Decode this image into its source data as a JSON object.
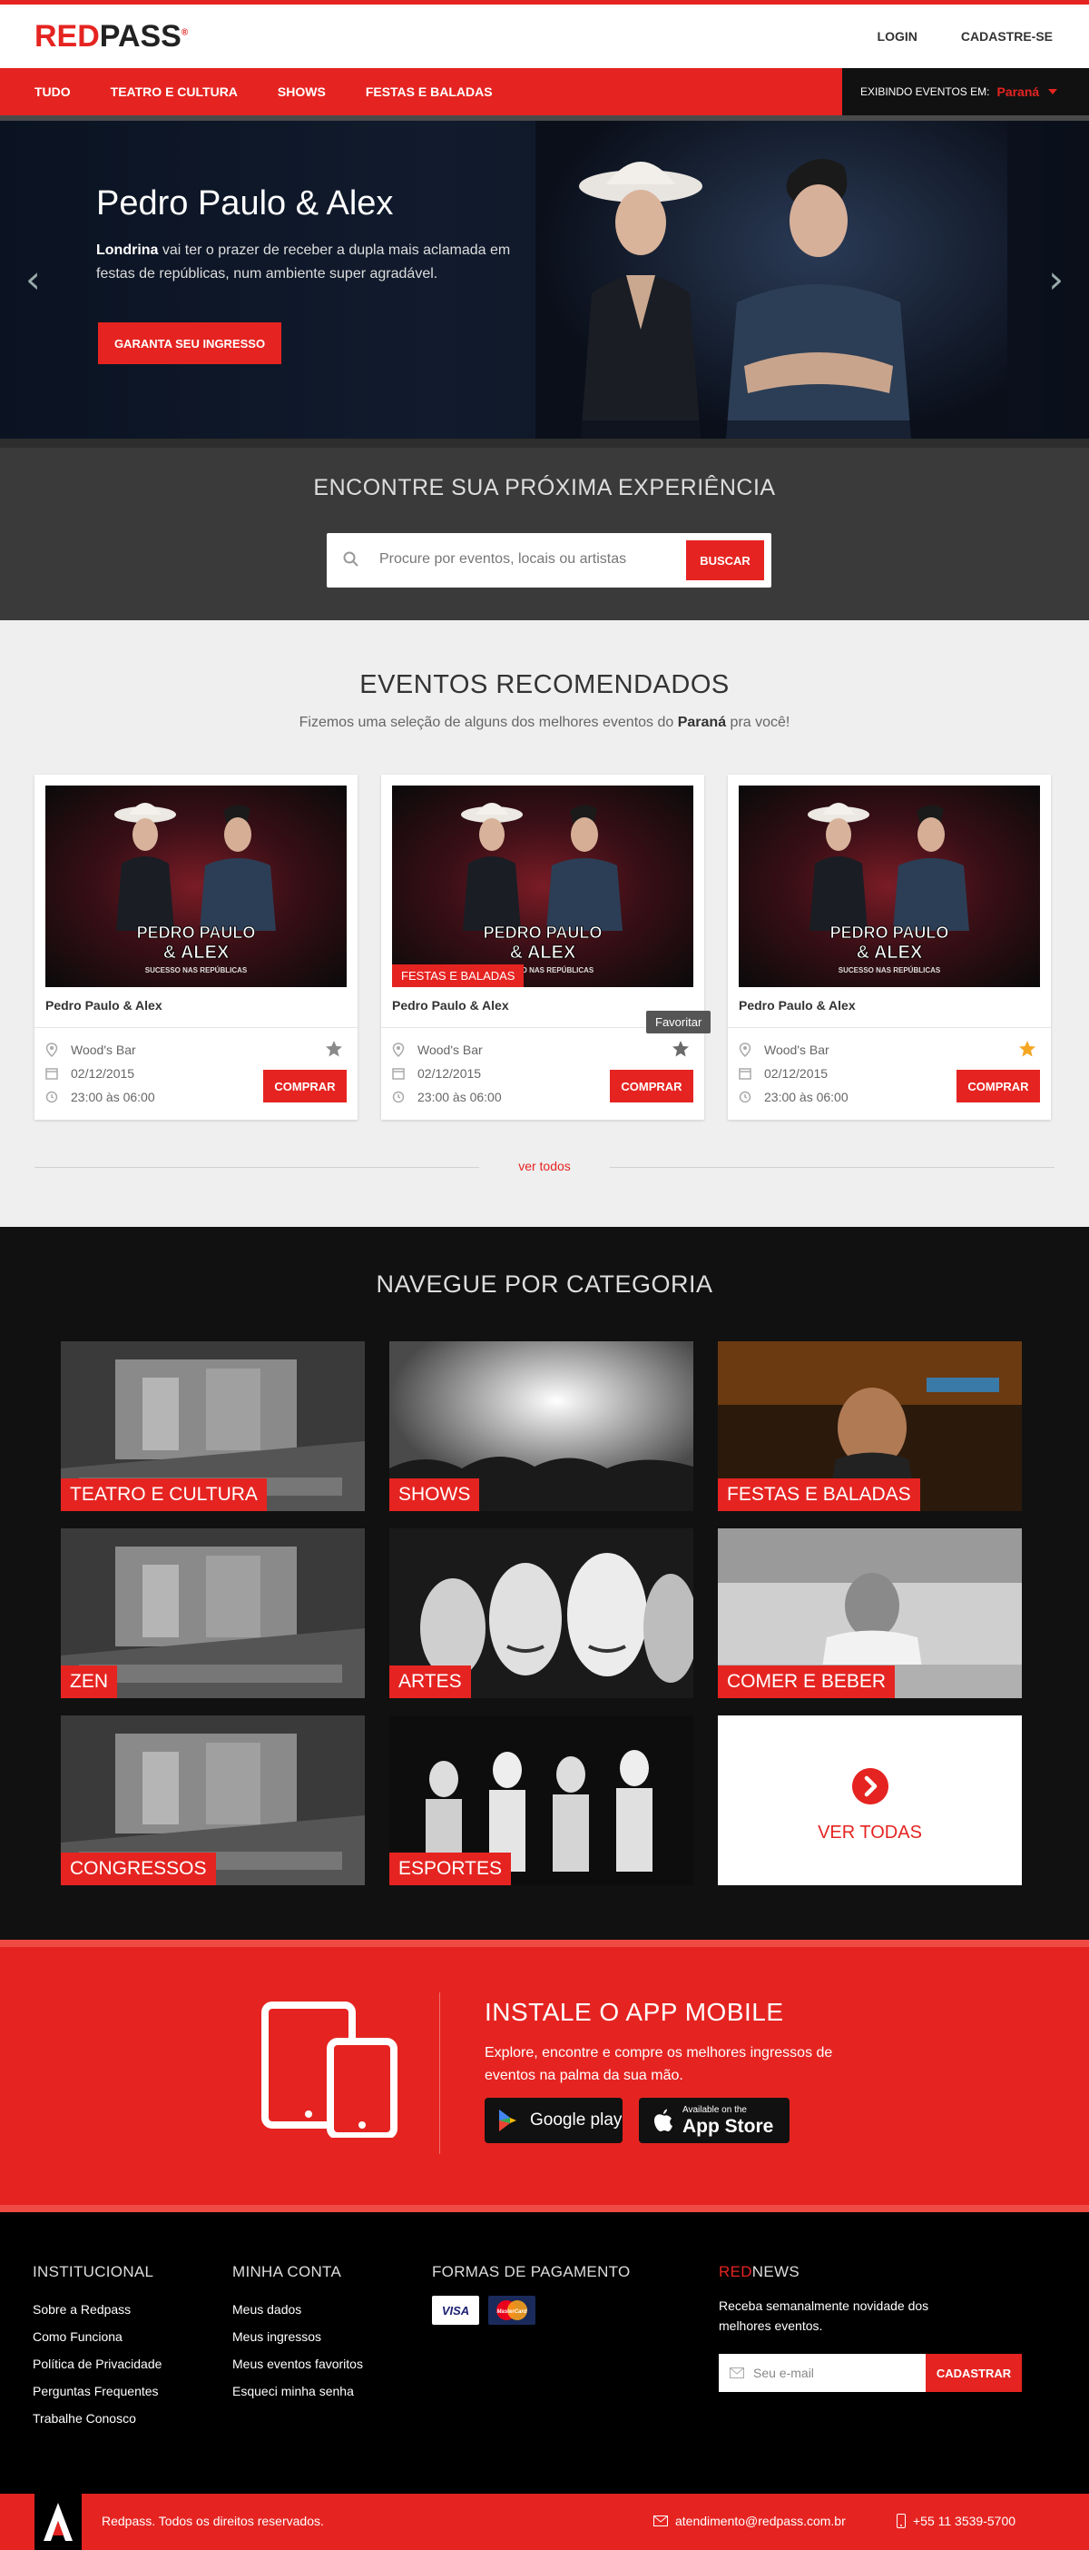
{
  "header": {
    "logo_red": "RED",
    "logo_dark": "PASS",
    "login": "LOGIN",
    "signup": "CADASTRE-SE"
  },
  "nav": {
    "items": [
      "TUDO",
      "TEATRO E CULTURA",
      "SHOWS",
      "FESTAS E BALADAS"
    ],
    "location_label": "EXIBINDO EVENTOS EM:",
    "location_value": "Paraná"
  },
  "hero": {
    "title": "Pedro Paulo & Alex",
    "desc_city": "Londrina",
    "desc_rest": " vai ter o prazer de receber a dupla mais aclamada em festas de repúblicas, num ambiente super agradável.",
    "button": "GARANTA SEU INGRESSO"
  },
  "search": {
    "title": "ENCONTRE SUA PRÓXIMA EXPERIÊNCIA",
    "placeholder": "Procure por eventos, locais ou artistas",
    "button": "BUSCAR"
  },
  "recommended": {
    "title": "EVENTOS RECOMENDADOS",
    "sub_before": "Fizemos uma seleção de alguns dos melhores eventos do ",
    "sub_state": "Paraná",
    "sub_after": " pra você!",
    "see_all": "ver todos",
    "tooltip": "Favoritar",
    "cards": [
      {
        "name": "Pedro Paulo & Alex",
        "venue": "Wood's Bar",
        "date": "02/12/2015",
        "time": "23:00 às 06:00",
        "buy": "COMPRAR",
        "tag": "",
        "favorite": false
      },
      {
        "name": "Pedro Paulo & Alex",
        "venue": "Wood's Bar",
        "date": "02/12/2015",
        "time": "23:00 às 06:00",
        "buy": "COMPRAR",
        "tag": "FESTAS E BALADAS",
        "favorite": false
      },
      {
        "name": "Pedro Paulo & Alex",
        "venue": "Wood's Bar",
        "date": "02/12/2015",
        "time": "23:00 às 06:00",
        "buy": "COMPRAR",
        "tag": "",
        "favorite": true
      }
    ],
    "poster_line1": "PEDRO PAULO",
    "poster_line2": "& ALEX",
    "poster_line3": "SUCESSO NAS REPÚBLICAS"
  },
  "categories": {
    "title": "NAVEGUE POR CATEGORIA",
    "items": [
      "TEATRO E CULTURA",
      "SHOWS",
      "FESTAS E BALADAS",
      "ZEN",
      "ARTES",
      "COMER E BEBER",
      "CONGRESSOS",
      "ESPORTES"
    ],
    "see_all": "VER TODAS"
  },
  "app": {
    "title": "INSTALE O APP MOBILE",
    "desc": "Explore, encontre e compre os melhores ingressos de eventos na palma da sua mão.",
    "google": "Google play",
    "apple_small": "Available on the",
    "apple_big": "App Store"
  },
  "footer": {
    "inst_title": "INSTITUCIONAL",
    "inst_items": [
      "Sobre a Redpass",
      "Como Funciona",
      "Política de Privacidade",
      "Perguntas Frequentes",
      "Trabalhe Conosco"
    ],
    "acct_title": "MINHA CONTA",
    "acct_items": [
      "Meus dados",
      "Meus ingressos",
      "Meus eventos favoritos",
      "Esqueci minha senha"
    ],
    "pay_title": "FORMAS DE PAGAMENTO",
    "pay_visa": "VISA",
    "pay_master": "MasterCard",
    "news_red": "RED",
    "news_rest": "NEWS",
    "news_desc": "Receba semanalmente novidade dos melhores eventos.",
    "news_placeholder": "Seu e-mail",
    "news_button": "CADASTRAR",
    "copyright": "Redpass. Todos os direitos reservados.",
    "email": "atendimento@redpass.com.br",
    "phone": "+55 11 3539-5700"
  },
  "colors": {
    "brand": "#e52421",
    "dark": "#111111",
    "star_active": "#f5a623"
  }
}
